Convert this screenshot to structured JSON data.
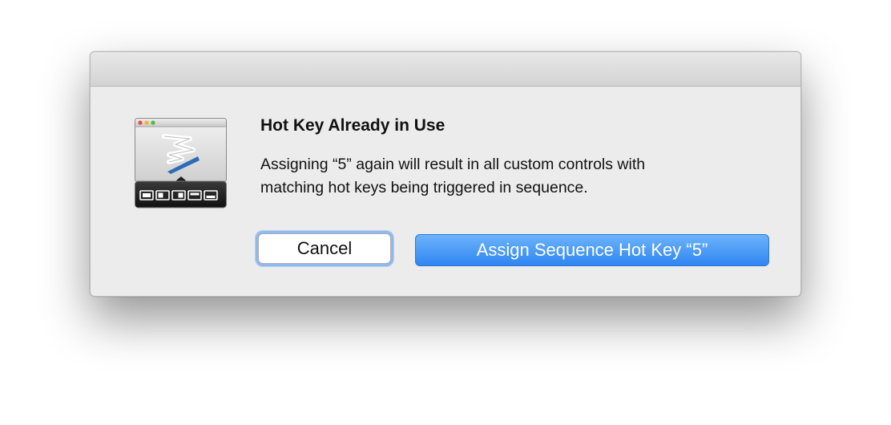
{
  "dialog": {
    "title": "Hot Key Already in Use",
    "message_lines": [
      "Assigning “5” again will result in all custom controls with",
      "matching hot keys being triggered in sequence."
    ],
    "app_icon": "app-window-icon",
    "buttons": {
      "cancel": "Cancel",
      "assign": "Assign Sequence Hot Key “5”"
    }
  },
  "colors": {
    "primary_button": "#2f85f1",
    "focus_ring": "#8fb8ee",
    "dialog_bg": "#ececec"
  }
}
